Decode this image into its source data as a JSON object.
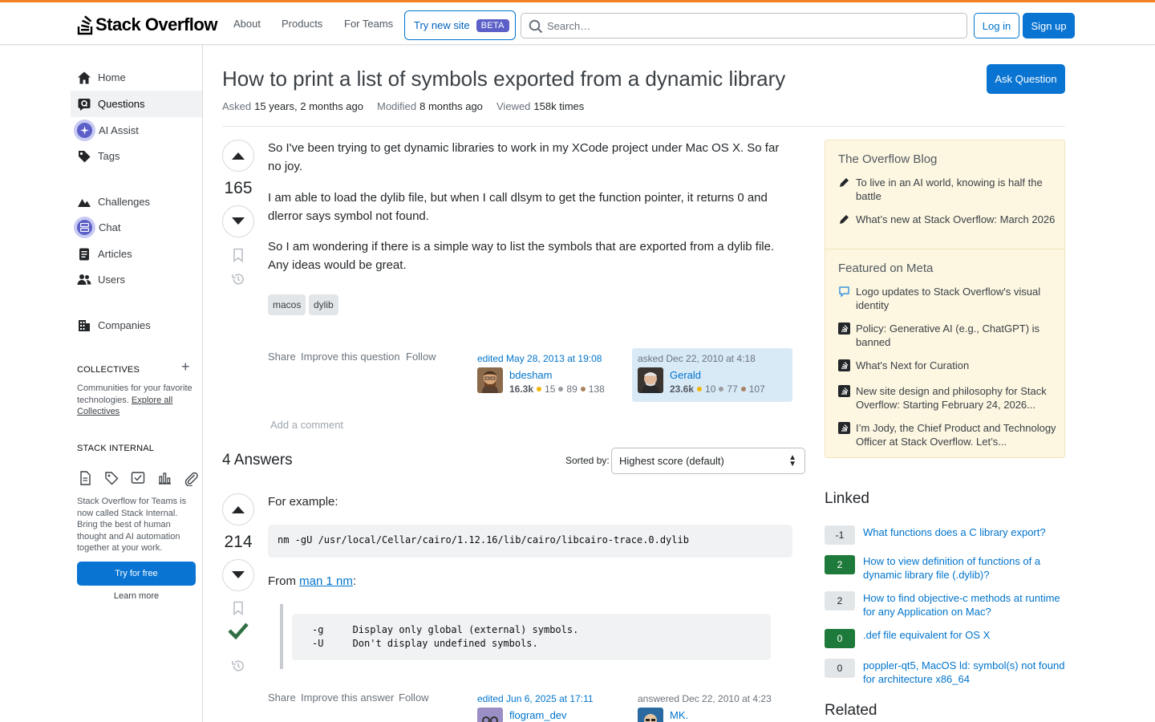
{
  "header": {
    "logo_text": "Stack Overflow",
    "nav": [
      "About",
      "Products",
      "For Teams"
    ],
    "try_new_site": "Try new site",
    "beta_badge": "BETA",
    "search_placeholder": "Search…",
    "login": "Log in",
    "signup": "Sign up",
    "accent_color": "#f48225"
  },
  "sidebar": {
    "items": [
      {
        "label": "Home",
        "icon": "home-icon"
      },
      {
        "label": "Questions",
        "icon": "questions-icon"
      },
      {
        "label": "AI Assist",
        "icon": "ai-assist-icon"
      },
      {
        "label": "Tags",
        "icon": "tag-icon"
      },
      {
        "label": "Challenges",
        "icon": "challenges-icon"
      },
      {
        "label": "Chat",
        "icon": "chat-icon"
      },
      {
        "label": "Articles",
        "icon": "articles-icon"
      },
      {
        "label": "Users",
        "icon": "users-icon"
      },
      {
        "label": "Companies",
        "icon": "companies-icon"
      }
    ],
    "collectives_heading": "COLLECTIVES",
    "collectives_text": "Communities for your favorite technologies.",
    "collectives_link": "Explore all Collectives",
    "internal_heading": "STACK INTERNAL",
    "internal_text": "Stack Overflow for Teams is now called Stack Internal. Bring the best of human thought and AI automation together at your work.",
    "try_free": "Try for free",
    "learn_more": "Learn more"
  },
  "question": {
    "title": "How to print a list of symbols exported from a dynamic library",
    "ask_button": "Ask Question",
    "asked_label": "Asked",
    "asked_value": "15 years, 2 months ago",
    "modified_label": "Modified",
    "modified_value": "8 months ago",
    "viewed_label": "Viewed",
    "viewed_value": "158k times",
    "score": "165",
    "paragraphs": [
      "So I've been trying to get dynamic libraries to work in my XCode project under Mac OS X. So far no joy.",
      "I am able to load the dylib file, but when I call dlsym to get the function pointer, it returns 0 and dlerror says symbol not found.",
      "So I am wondering if there is a simple way to list the symbols that are exported from a dylib file. Any ideas would be great."
    ],
    "tags": [
      "macos",
      "dylib"
    ],
    "menu": [
      "Share",
      "Improve this question",
      "Follow"
    ],
    "editor": {
      "action": "edited May 28, 2013 at 19:08",
      "name": "bdesham",
      "rep": "16.3k",
      "gold": "15",
      "silver": "89",
      "bronze": "138"
    },
    "owner": {
      "action": "asked Dec 22, 2010 at 4:18",
      "name": "Gerald",
      "rep": "23.6k",
      "gold": "10",
      "silver": "77",
      "bronze": "107"
    },
    "add_comment": "Add a comment"
  },
  "answers": {
    "heading": "4 Answers",
    "sorted_by": "Sorted by:",
    "sort_value": "Highest score (default)",
    "first": {
      "score": "214",
      "intro": "For example:",
      "code": "nm -gU /usr/local/Cellar/cairo/1.12.16/lib/cairo/libcairo-trace.0.dylib",
      "from_text": "From",
      "from_link": "man 1 nm",
      "from_suffix": ":",
      "quote_line1": "-g     Display only global (external) symbols.",
      "quote_line2": "-U     Don't display undefined symbols.",
      "menu": [
        "Share",
        "Improve this answer",
        "Follow"
      ],
      "editor": {
        "action": "edited Jun 6, 2025 at 17:11",
        "name": "flogram_dev"
      },
      "owner": {
        "action": "answered Dec 22, 2010 at 4:23",
        "name": "MK."
      }
    }
  },
  "right": {
    "blog_heading": "The Overflow Blog",
    "blog_items": [
      "To live in an AI world, knowing is half the battle",
      "What’s new at Stack Overflow: March 2026"
    ],
    "meta_heading": "Featured on Meta",
    "meta_items": [
      "Logo updates to Stack Overflow's visual identity",
      "Policy: Generative AI (e.g., ChatGPT) is banned",
      "What's Next for Curation",
      "New site design and philosophy for Stack Overflow: Starting February 24, 2026...",
      "I’m Jody, the Chief Product and Technology Officer at Stack Overflow. Let’s..."
    ],
    "linked_heading": "Linked",
    "linked": [
      {
        "score": "-1",
        "title": "What functions does a C library export?",
        "accepted": false
      },
      {
        "score": "2",
        "title": "How to view definition of functions of a dynamic library file (.dylib)?",
        "accepted": true
      },
      {
        "score": "2",
        "title": "How to find objective-c methods at runtime for any Application on Mac?",
        "accepted": false
      },
      {
        "score": "0",
        "title": ".def file equivalent for OS X",
        "accepted": true
      },
      {
        "score": "0",
        "title": "poppler-qt5, MacOS ld: symbol(s) not found for architecture x86_64",
        "accepted": false
      }
    ],
    "related_heading": "Related"
  }
}
